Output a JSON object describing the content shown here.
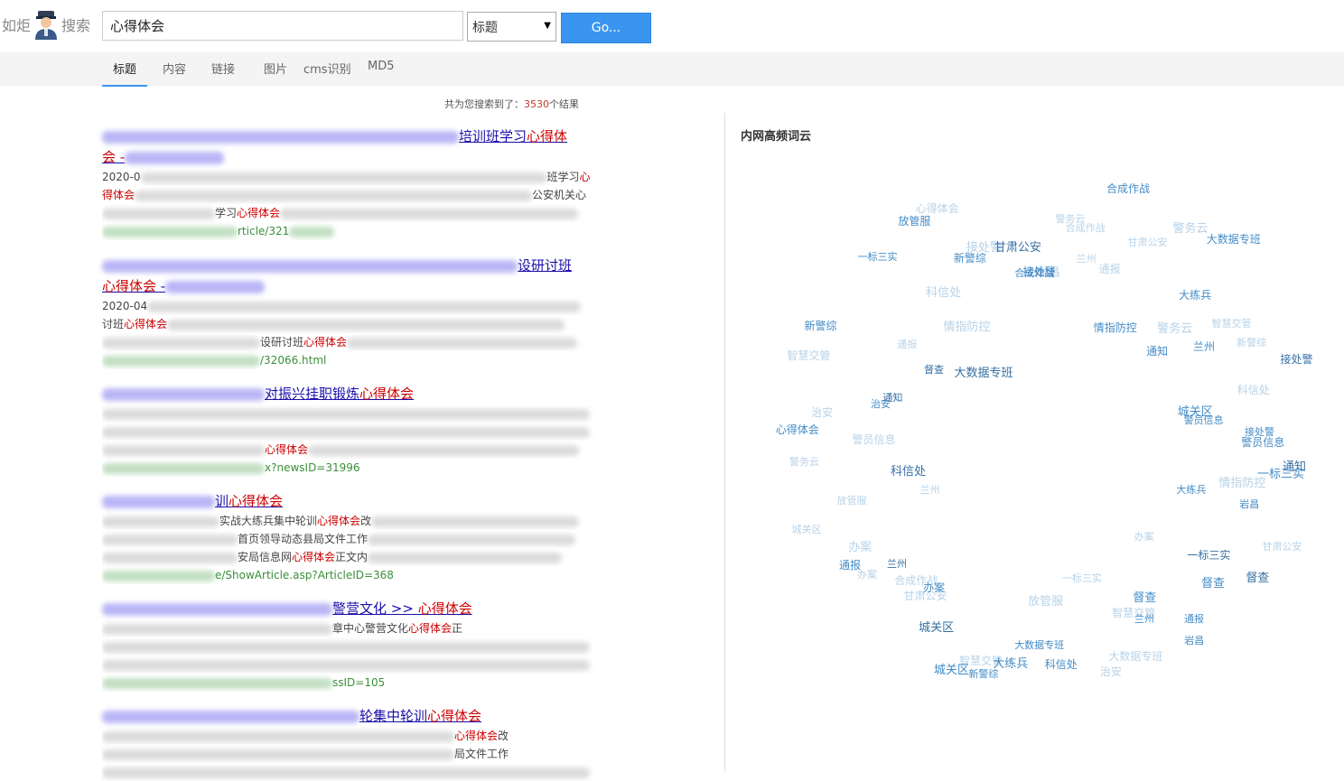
{
  "header": {
    "logo_left": "如炬",
    "logo_right": "搜索",
    "search_value": "心得体会",
    "select_value": "标题",
    "go_label": "Go..."
  },
  "tabs": [
    "标题",
    "内容",
    "链接",
    "图片",
    "cms识别",
    "MD5"
  ],
  "result_count": {
    "prefix": "共为您搜索到了：",
    "count": "3530",
    "suffix": "个结果"
  },
  "results": [
    {
      "title_parts": [
        "培训班学习",
        "心得体",
        "会 -"
      ],
      "lines": [
        [
          "2020-0",
          "",
          "班学习",
          "心"
        ],
        [
          "得体会",
          "",
          "公安机关心"
        ],
        [
          "",
          "学习",
          "心得体会",
          ""
        ]
      ],
      "url": "rticle/321"
    },
    {
      "title_parts": [
        "设研讨班",
        "心得体会",
        " -"
      ],
      "lines": [
        [
          "2020-04",
          ""
        ],
        [
          "讨班",
          "心得体会",
          ""
        ],
        [
          "",
          "设研讨班",
          "心得体会",
          ""
        ]
      ],
      "url": "/32066.html"
    },
    {
      "title_parts": [
        "对振兴挂职锻炼",
        "心得体会"
      ],
      "lines": [
        [
          "",
          ""
        ],
        [
          "",
          ""
        ],
        [
          "",
          "心得体会",
          ""
        ]
      ],
      "url": "x?newsID=31996"
    },
    {
      "title_parts": [
        "训",
        "心得体会"
      ],
      "lines": [
        [
          "",
          "实战大练兵集中轮训",
          "心得体会",
          "改"
        ],
        [
          "",
          "首页领导动态县局文件工作"
        ],
        [
          "",
          "安局信息网",
          "心得体会",
          "正文内"
        ]
      ],
      "url": "e/ShowArticle.asp?ArticleID=368"
    },
    {
      "title_parts": [
        "警营文化 >> ",
        "心得体会"
      ],
      "lines": [
        [
          "",
          "章中心警营文化",
          "心得体会",
          "正"
        ],
        [
          "",
          ""
        ],
        [
          "",
          ""
        ]
      ],
      "url": "ssID=105"
    },
    {
      "title_parts": [
        "轮集中轮训",
        "心得体会"
      ],
      "lines": [
        [
          "",
          "心得体会",
          "改"
        ],
        [
          "",
          "局文件工作"
        ],
        [
          "",
          ""
        ]
      ],
      "url": ""
    }
  ],
  "cloud": {
    "title": "内网高频词云",
    "words": [
      "接处警",
      "兰州",
      "警务云",
      "通报",
      "治安",
      "智慧交管",
      "新警综",
      "心得体会",
      "岩昌",
      "城关区",
      "甘肃公安",
      "大数据专班",
      "督查",
      "科信处",
      "办案",
      "合成作战",
      "一标三实",
      "警员信息",
      "大练兵",
      "放管服",
      "情指防控",
      "通知",
      "通报",
      "兰州",
      "督查",
      "智慧交管",
      "新警综",
      "城关区",
      "接处警",
      "甘肃公安",
      "科信处",
      "警务云",
      "一标三实",
      "大数据专班",
      "警员信息",
      "合成作战",
      "岩昌",
      "办案",
      "治安",
      "通知",
      "大练兵",
      "放管服",
      "情指防控",
      "兰州",
      "通报",
      "智慧交管",
      "新警综",
      "接处警",
      "城关区",
      "甘肃公安",
      "督查",
      "警务云",
      "大数据专班",
      "科信处",
      "一标三实",
      "警员信息",
      "办案",
      "合成作战",
      "岩昌",
      "通知",
      "兰州",
      "智慧交管",
      "新警综",
      "大练兵",
      "放管服",
      "情指防控",
      "治安",
      "通报",
      "城关区",
      "甘肃公安",
      "接处警",
      "督查",
      "心得体会",
      "警务云",
      "大数据专班",
      "科信处",
      "一标三实",
      "办案",
      "合成作战",
      "兰州"
    ]
  }
}
